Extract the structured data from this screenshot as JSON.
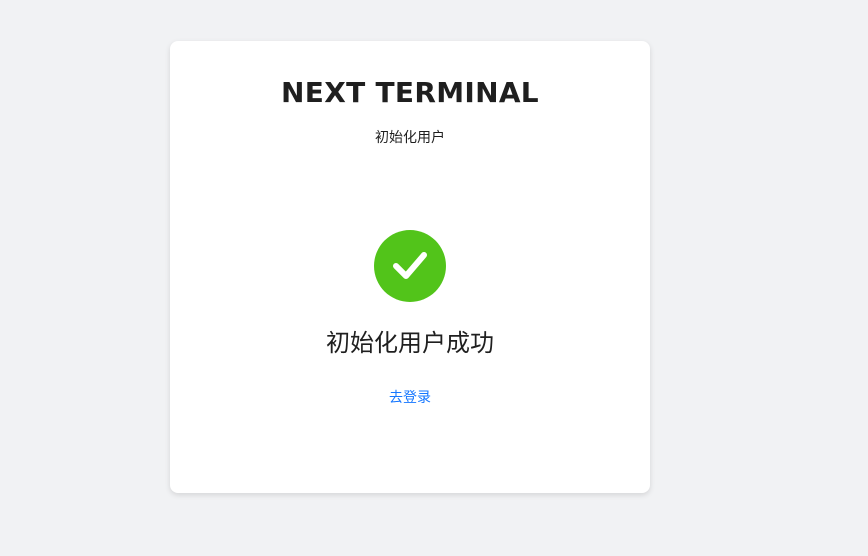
{
  "app": {
    "title": "NEXT TERMINAL",
    "subtitle": "初始化用户"
  },
  "result": {
    "status": "success",
    "icon": "check-circle-icon",
    "title": "初始化用户成功",
    "link_label": "去登录"
  },
  "colors": {
    "background": "#f1f2f4",
    "card": "#ffffff",
    "success": "#52c41a",
    "link": "#1677ff",
    "text": "#1f1f1f"
  }
}
